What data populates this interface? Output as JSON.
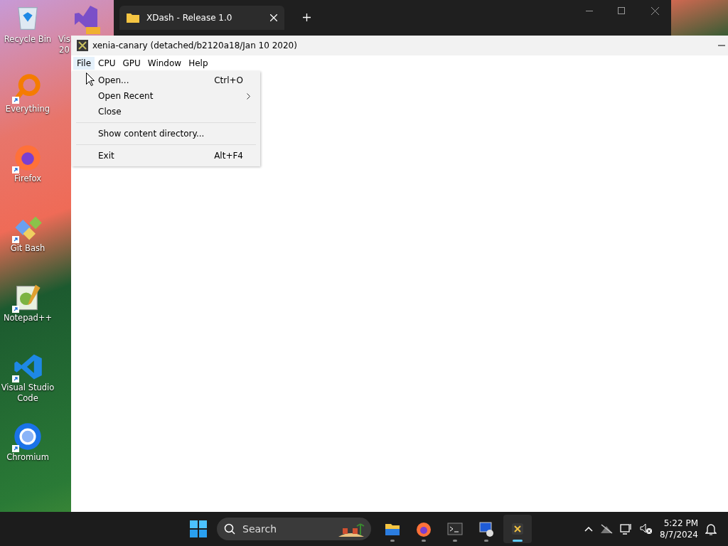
{
  "desktop_icons": [
    {
      "label": "Recycle Bin",
      "shortcut": false
    },
    {
      "label": "Everything",
      "shortcut": true
    },
    {
      "label": "Firefox",
      "shortcut": true
    },
    {
      "label": "Git Bash",
      "shortcut": true
    },
    {
      "label": "Notepad++",
      "shortcut": true
    },
    {
      "label": "Visual Studio Code",
      "shortcut": true
    },
    {
      "label": "Chromium",
      "shortcut": true
    }
  ],
  "hidden_icon": {
    "label": "Vis\n20"
  },
  "explorer_window": {
    "tab_title": "XDash - Release 1.0"
  },
  "xenia_window": {
    "title": "xenia-canary (detached/b2120a18/Jan 10 2020)",
    "menus": [
      {
        "label": "File",
        "selected": true
      },
      {
        "label": "CPU",
        "selected": false
      },
      {
        "label": "GPU",
        "selected": false
      },
      {
        "label": "Window",
        "selected": false
      },
      {
        "label": "Help",
        "selected": false
      }
    ],
    "file_menu": [
      {
        "kind": "item",
        "label": "Open...",
        "shortcut": "Ctrl+O"
      },
      {
        "kind": "submenu",
        "label": "Open Recent"
      },
      {
        "kind": "item",
        "label": "Close"
      },
      {
        "kind": "separator"
      },
      {
        "kind": "item",
        "label": "Show content directory..."
      },
      {
        "kind": "separator"
      },
      {
        "kind": "item",
        "label": "Exit",
        "shortcut": "Alt+F4"
      }
    ]
  },
  "taskbar": {
    "search": {
      "placeholder": "Search"
    },
    "apps": [
      {
        "active": false
      },
      {
        "active": false
      },
      {
        "active": false
      },
      {
        "active": false
      },
      {
        "active": true
      }
    ],
    "clock": {
      "time": "5:22 PM",
      "date": "8/7/2024"
    }
  }
}
